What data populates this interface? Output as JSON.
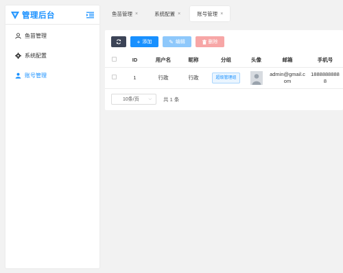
{
  "app": {
    "title": "管理后台",
    "brand_color": "#1890ff"
  },
  "sidebar": {
    "items": [
      {
        "label": "鱼苗管理",
        "icon": "user-outline-icon",
        "active": false
      },
      {
        "label": "系统配置",
        "icon": "gear-icon",
        "active": false
      },
      {
        "label": "账号管理",
        "icon": "user-filled-icon",
        "active": true
      }
    ]
  },
  "tabs": [
    {
      "label": "鱼苗管理",
      "close": "×",
      "active": false
    },
    {
      "label": "系统配置",
      "close": "×",
      "active": false
    },
    {
      "label": "账号管理",
      "close": "×",
      "active": true
    }
  ],
  "toolbar": {
    "refresh_icon": "refresh-icon",
    "add_label": "添加",
    "edit_label": "编辑",
    "delete_label": "删除",
    "colors": {
      "refresh": "#3c4457",
      "add": "#1890ff",
      "edit": "#8ec8fb",
      "delete": "#f7a6a6"
    }
  },
  "table": {
    "columns": [
      "ID",
      "用户名",
      "昵称",
      "分组",
      "头像",
      "邮箱",
      "手机号"
    ],
    "rows": [
      {
        "id": "1",
        "username": "行政",
        "nickname": "行政",
        "group": "超级管理组",
        "avatar": "default-avatar-icon",
        "email": "admin@gmail.com",
        "phone": "18888888888"
      }
    ]
  },
  "pagination": {
    "page_size": "10条/页",
    "total": "共 1 条"
  }
}
